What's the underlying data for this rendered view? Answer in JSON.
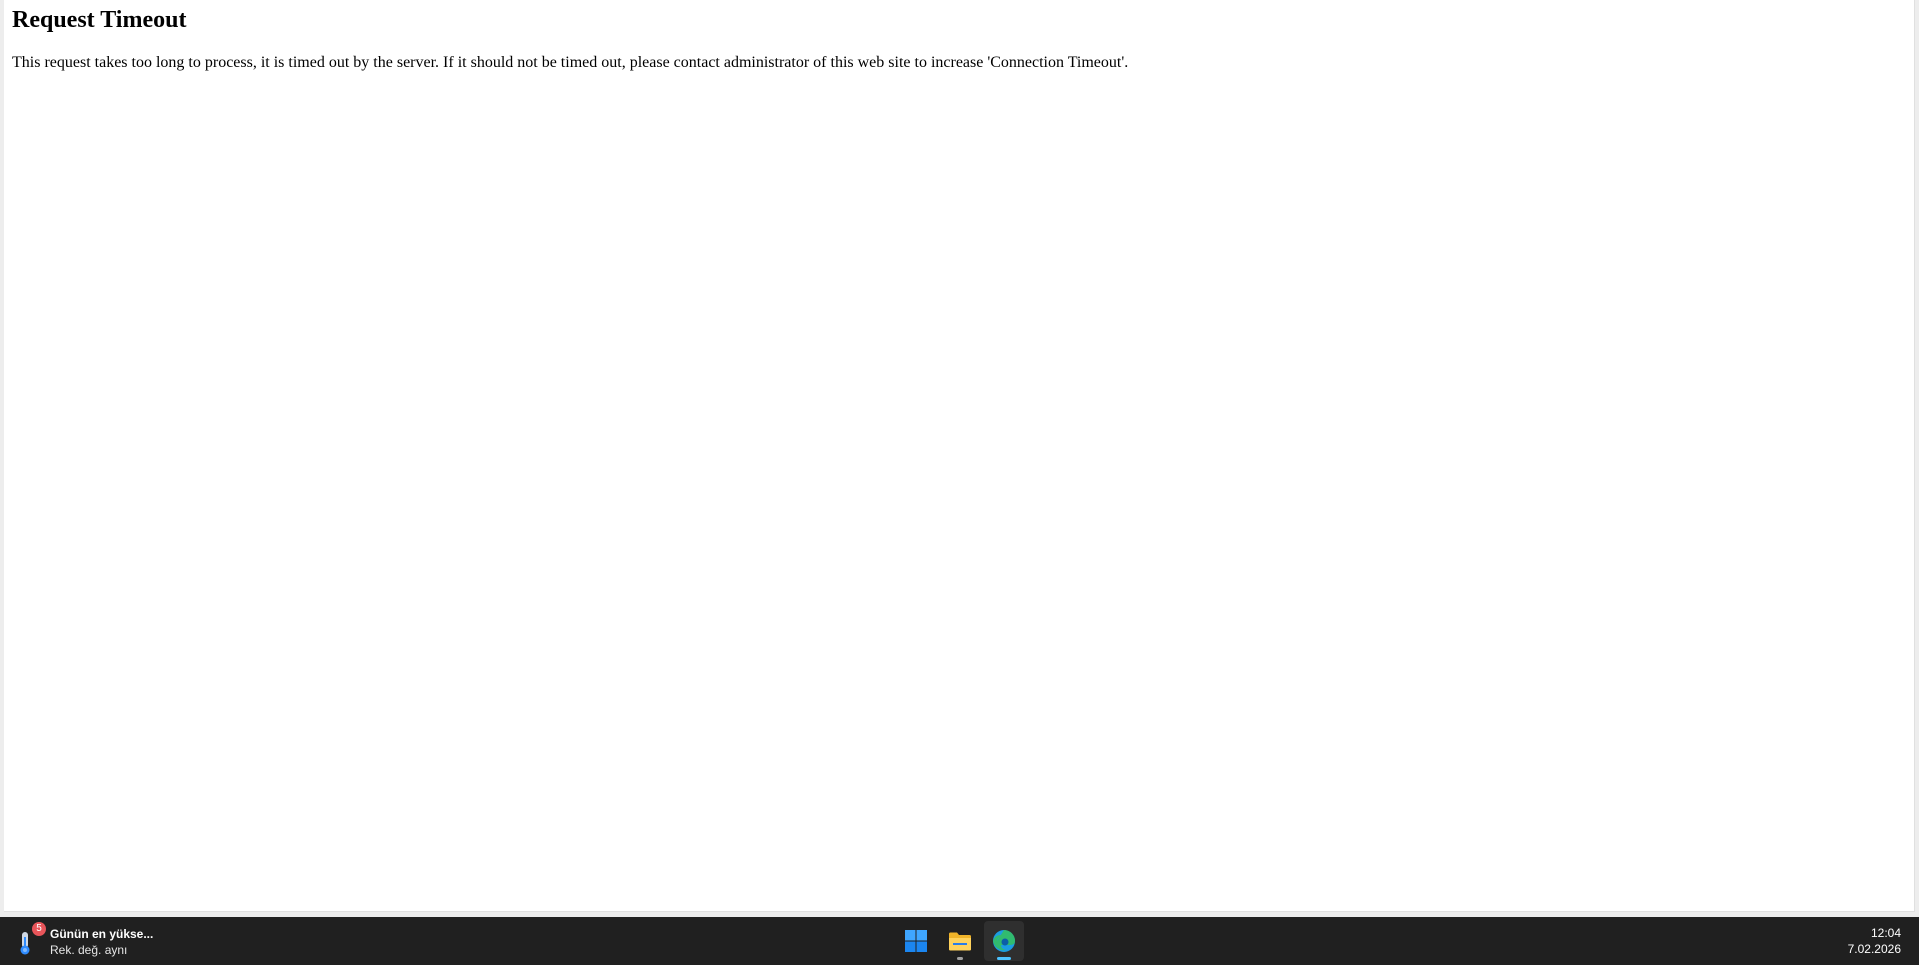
{
  "page": {
    "title": "Request Timeout",
    "message": "This request takes too long to process, it is timed out by the server. If it should not be timed out, please contact administrator of this web site to increase 'Connection Timeout'."
  },
  "taskbar": {
    "widget": {
      "icon": "thermometer-icon",
      "badge": "5",
      "title": "Günün en yükse...",
      "subtitle": "Rek. değ. aynı"
    },
    "apps": [
      {
        "name": "start",
        "icon": "windows-logo-icon",
        "running": false,
        "active": false
      },
      {
        "name": "file-explorer",
        "icon": "folder-icon",
        "running": true,
        "active": false
      },
      {
        "name": "edge",
        "icon": "edge-browser-icon",
        "running": true,
        "active": true
      }
    ],
    "clock": {
      "time": "12:04",
      "date": "7.02.2026"
    }
  },
  "colors": {
    "taskbar_bg": "#202020",
    "accent": "#4cc2ff",
    "badge": "#e8555a"
  }
}
